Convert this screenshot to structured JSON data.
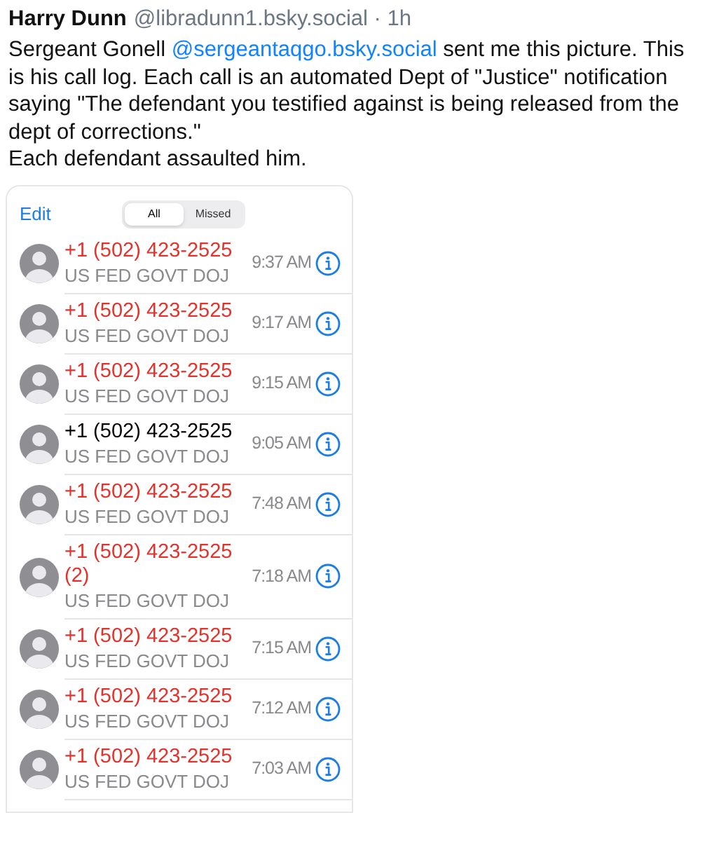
{
  "post": {
    "author": "Harry Dunn",
    "meta": "@libradunn1.bsky.social · 1h",
    "body": [
      {
        "kind": "text",
        "text": "Sergeant Gonell "
      },
      {
        "kind": "mention",
        "text": "@sergeantaqgo.bsky.social"
      },
      {
        "kind": "text",
        "text": " sent me this picture. This is his call log. Each call is an automated Dept of \"Justice\" notification saying \"The defendant you testified against is being released from the dept of corrections.\""
      },
      {
        "kind": "break"
      },
      {
        "kind": "text",
        "text": "Each defendant assaulted him."
      }
    ]
  },
  "call_log": {
    "edit": "Edit",
    "tabs": [
      {
        "label": "All",
        "selected": true
      },
      {
        "label": "Missed",
        "selected": false
      }
    ],
    "calls": [
      {
        "number": "+1 (502) 423-2525",
        "label": "US FED GOVT DOJ",
        "time": "9:37 AM",
        "missed": true
      },
      {
        "number": "+1 (502) 423-2525",
        "label": "US FED GOVT DOJ",
        "time": "9:17 AM",
        "missed": true
      },
      {
        "number": "+1 (502) 423-2525",
        "label": "US FED GOVT DOJ",
        "time": "9:15 AM",
        "missed": true
      },
      {
        "number": "+1 (502) 423-2525",
        "label": "US FED GOVT DOJ",
        "time": "9:05 AM",
        "missed": false
      },
      {
        "number": "+1 (502) 423-2525",
        "label": "US FED GOVT DOJ",
        "time": "7:48 AM",
        "missed": true
      },
      {
        "number": "+1 (502) 423-2525",
        "count": "(2)",
        "label": "US FED GOVT DOJ",
        "time": "7:18 AM",
        "missed": true
      },
      {
        "number": "+1 (502) 423-2525",
        "label": "US FED GOVT DOJ",
        "time": "7:15 AM",
        "missed": true
      },
      {
        "number": "+1 (502) 423-2525",
        "label": "US FED GOVT DOJ",
        "time": "7:12 AM",
        "missed": true
      },
      {
        "number": "+1 (502) 423-2525",
        "label": "US FED GOVT DOJ",
        "time": "7:03 AM",
        "missed": true
      }
    ]
  }
}
